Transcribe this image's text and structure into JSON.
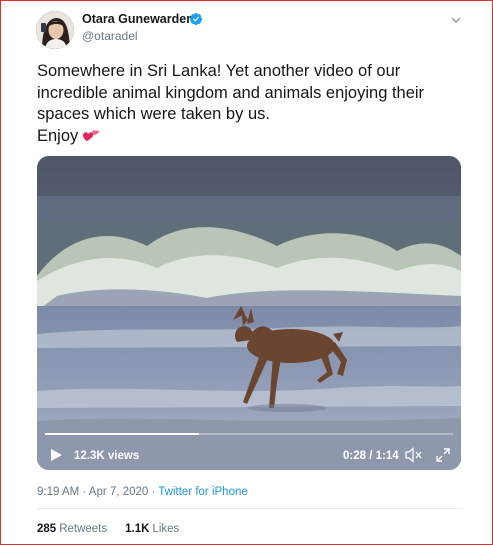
{
  "author": {
    "display_name": "Otara Gunewardene",
    "handle": "@otaradel",
    "verified": true
  },
  "tweet": {
    "lines": [
      "Somewhere in Sri Lanka! Yet another video of our",
      "incredible animal kingdom and animals enjoying their",
      "spaces which were taken by us.",
      "Enjoy"
    ],
    "emoji": "two-hearts-icon"
  },
  "video": {
    "views": "12.3K views",
    "time": "0:28 / 1:14",
    "progress_fraction": 0.378
  },
  "meta": {
    "time": "9:19 AM",
    "separator1": " · ",
    "date": "Apr 7, 2020",
    "separator2": " · ",
    "source": "Twitter for iPhone"
  },
  "stats": {
    "retweets_count": "285",
    "retweets_label": "Retweets",
    "likes_count": "1.1K",
    "likes_label": "Likes"
  },
  "colors": {
    "accent": "#1b95e0",
    "secondary_text": "#657786",
    "frame_border": "#d9342b"
  }
}
